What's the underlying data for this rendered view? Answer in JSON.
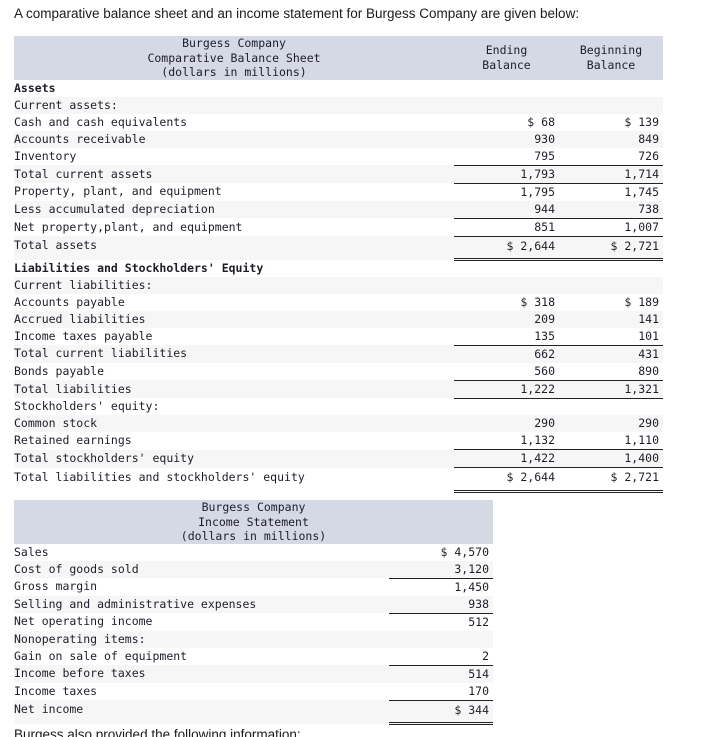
{
  "prompt": "A comparative balance sheet and an income statement for Burgess Company are given below:",
  "footer_partial": "Burgess also provided the following information:",
  "colors": {
    "header_band": "#d4d9e4",
    "row_stripe": "#f6f6f7",
    "text": "#1d1d29",
    "rule": "#222222"
  },
  "balance_sheet": {
    "title_lines": [
      "Burgess Company",
      "Comparative Balance Sheet",
      "(dollars in millions)"
    ],
    "columns": [
      {
        "line1": "Ending",
        "line2": "Balance"
      },
      {
        "line1": "Beginning",
        "line2": "Balance"
      }
    ],
    "rows": [
      {
        "label": "Assets",
        "indent": 0,
        "bold": true,
        "ending": "",
        "beginning": ""
      },
      {
        "label": "Current assets:",
        "indent": 0,
        "ending": "",
        "beginning": ""
      },
      {
        "label": "Cash and cash equivalents",
        "indent": 1,
        "ending": "$ 68",
        "beginning": "$ 139"
      },
      {
        "label": "Accounts receivable",
        "indent": 1,
        "ending": "930",
        "beginning": "849"
      },
      {
        "label": "Inventory",
        "indent": 1,
        "ending": "795",
        "beginning": "726",
        "rule": "single"
      },
      {
        "label": "Total current assets",
        "indent": 0,
        "ending": "1,793",
        "beginning": "1,714",
        "rule": "single"
      },
      {
        "label": "Property, plant, and equipment",
        "indent": 0,
        "ending": "1,795",
        "beginning": "1,745"
      },
      {
        "label": "Less accumulated depreciation",
        "indent": 1,
        "ending": "944",
        "beginning": "738",
        "rule": "single"
      },
      {
        "label": "Net property,plant, and equipment",
        "indent": 0,
        "ending": "851",
        "beginning": "1,007",
        "rule": "single"
      },
      {
        "label": "Total assets",
        "indent": 0,
        "ending": "$ 2,644",
        "beginning": "$ 2,721",
        "rule": "double",
        "gap": true
      },
      {
        "label": "Liabilities and Stockholders' Equity",
        "indent": 0,
        "bold": true,
        "ending": "",
        "beginning": ""
      },
      {
        "label": "Current liabilities:",
        "indent": 0,
        "ending": "",
        "beginning": ""
      },
      {
        "label": "Accounts payable",
        "indent": 1,
        "ending": "$ 318",
        "beginning": "$ 189"
      },
      {
        "label": "Accrued liabilities",
        "indent": 1,
        "ending": "209",
        "beginning": "141"
      },
      {
        "label": "Income taxes payable",
        "indent": 1,
        "ending": "135",
        "beginning": "101",
        "rule": "single"
      },
      {
        "label": "Total current liabilities",
        "indent": 0,
        "ending": "662",
        "beginning": "431"
      },
      {
        "label": "Bonds payable",
        "indent": 0,
        "ending": "560",
        "beginning": "890",
        "rule": "single"
      },
      {
        "label": "Total liabilities",
        "indent": 0,
        "ending": "1,222",
        "beginning": "1,321",
        "rule": "single"
      },
      {
        "label": "Stockholders' equity:",
        "indent": 0,
        "ending": "",
        "beginning": ""
      },
      {
        "label": "Common stock",
        "indent": 1,
        "ending": "290",
        "beginning": "290"
      },
      {
        "label": "Retained earnings",
        "indent": 1,
        "ending": "1,132",
        "beginning": "1,110",
        "rule": "single"
      },
      {
        "label": "Total stockholders' equity",
        "indent": 0,
        "ending": "1,422",
        "beginning": "1,400",
        "rule": "single"
      },
      {
        "label": "Total liabilities and stockholders' equity",
        "indent": 0,
        "ending": "$ 2,644",
        "beginning": "$ 2,721",
        "rule": "double",
        "gap": true
      }
    ]
  },
  "income_statement": {
    "title_lines": [
      "Burgess Company",
      "Income Statement",
      "(dollars in millions)"
    ],
    "rows": [
      {
        "label": "Sales",
        "indent": 0,
        "amount": "$ 4,570"
      },
      {
        "label": "Cost of goods sold",
        "indent": 0,
        "amount": "3,120",
        "rule": "single"
      },
      {
        "label": "Gross margin",
        "indent": 0,
        "amount": "1,450"
      },
      {
        "label": "Selling and administrative expenses",
        "indent": 0,
        "amount": "938",
        "rule": "single"
      },
      {
        "label": "Net operating income",
        "indent": 0,
        "amount": "512"
      },
      {
        "label": "Nonoperating items:",
        "indent": 0,
        "amount": ""
      },
      {
        "label": "Gain on sale of equipment",
        "indent": 1,
        "amount": "2",
        "rule": "single"
      },
      {
        "label": "Income before taxes",
        "indent": 0,
        "amount": "514"
      },
      {
        "label": "Income taxes",
        "indent": 0,
        "amount": "170",
        "rule": "single"
      },
      {
        "label": "Net income",
        "indent": 0,
        "amount": "$ 344",
        "rule": "double",
        "gap": true
      }
    ]
  }
}
